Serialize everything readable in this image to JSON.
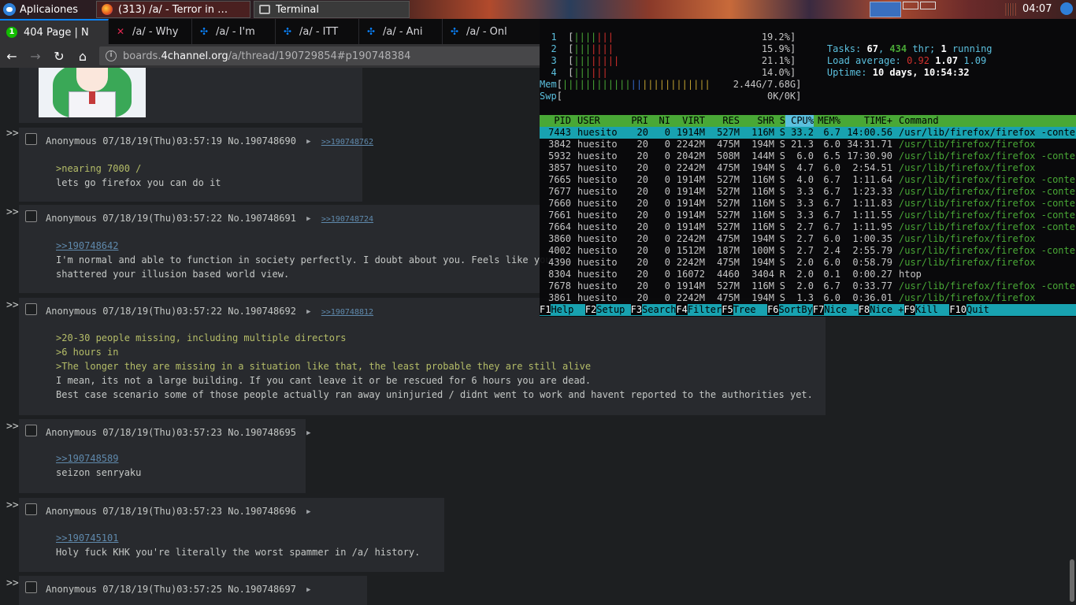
{
  "panel": {
    "apps_label": "Aplicaiones",
    "tasks": [
      {
        "title": "(313) /a/ - Terror in …",
        "icon": "firefox-icon"
      },
      {
        "title": "Terminal",
        "icon": "terminal-icon"
      }
    ],
    "clock": "04:07"
  },
  "browser": {
    "tabs": [
      {
        "badge": "1",
        "title": "404 Page | N"
      },
      {
        "title": "/a/ - Why"
      },
      {
        "title": "/a/ - I'm"
      },
      {
        "title": "/a/ - ITT"
      },
      {
        "title": "/a/ - Ani"
      },
      {
        "title": "/a/ - Onl"
      }
    ],
    "url_domain_prefix": "boards.",
    "url_domain": "4channel.org",
    "url_path": "/a/thread/190729854#p190748384"
  },
  "posts": [
    {
      "name": "Anonymous",
      "date": "07/18/19(Thu)03:57:19",
      "no": "No.190748690",
      "backlink": ">>190748762",
      "lines": [
        {
          "t": ">nearing 7000 /",
          "k": "quote"
        },
        {
          "t": "lets go firefox you can do it",
          "k": "text"
        }
      ]
    },
    {
      "name": "Anonymous",
      "date": "07/18/19(Thu)03:57:22",
      "no": "No.190748691",
      "backlink": ">>190748724",
      "lines": [
        {
          "t": ">>190748642",
          "k": "link"
        },
        {
          "t": "I'm normal and able to function in society perfectly. I doubt about you. Feels like you",
          "k": "text"
        },
        {
          "t": "shattered your illusion based world view.",
          "k": "text"
        }
      ]
    },
    {
      "name": "Anonymous",
      "date": "07/18/19(Thu)03:57:22",
      "no": "No.190748692",
      "backlink": ">>190748812",
      "lines": [
        {
          "t": ">20-30 people missing, including multiple directors",
          "k": "quote"
        },
        {
          "t": ">6 hours in",
          "k": "quote"
        },
        {
          "t": ">The longer they are missing in a situation like that, the least probable they are still alive",
          "k": "quote"
        },
        {
          "t": "I mean, its not a large building. If you cant leave it or be rescued for 6 hours you are dead.",
          "k": "text"
        },
        {
          "t": "Best case scenario some of those people actually ran away uninjuried / didnt went to work and havent reported to the authorities yet.",
          "k": "text"
        }
      ]
    },
    {
      "name": "Anonymous",
      "date": "07/18/19(Thu)03:57:23",
      "no": "No.190748695",
      "backlink": "",
      "lines": [
        {
          "t": ">>190748589",
          "k": "link"
        },
        {
          "t": "seizon senryaku",
          "k": "text"
        }
      ]
    },
    {
      "name": "Anonymous",
      "date": "07/18/19(Thu)03:57:23",
      "no": "No.190748696",
      "backlink": "",
      "lines": [
        {
          "t": ">>190745101",
          "k": "link"
        },
        {
          "t": "Holy fuck KHK you're literally the worst spammer in /a/ history.",
          "k": "text"
        }
      ]
    },
    {
      "name": "Anonymous",
      "date": "07/18/19(Thu)03:57:25",
      "no": "No.190748697",
      "backlink": "",
      "lines": []
    }
  ],
  "post_arrow": ">>",
  "htop": {
    "cpus": [
      {
        "n": "1",
        "bars": [
          {
            "c": "g",
            "t": "||||"
          },
          {
            "c": "r",
            "t": "|||"
          }
        ],
        "pct": "19.2%"
      },
      {
        "n": "2",
        "bars": [
          {
            "c": "g",
            "t": "|||"
          },
          {
            "c": "r",
            "t": "||||"
          }
        ],
        "pct": "15.9%"
      },
      {
        "n": "3",
        "bars": [
          {
            "c": "g",
            "t": "|||"
          },
          {
            "c": "r",
            "t": "|||||"
          }
        ],
        "pct": "21.1%"
      },
      {
        "n": "4",
        "bars": [
          {
            "c": "g",
            "t": "|||"
          },
          {
            "c": "r",
            "t": "|||"
          }
        ],
        "pct": "14.0%"
      }
    ],
    "mem": {
      "label": "Mem",
      "bars": [
        {
          "c": "g",
          "t": "||||||||||||"
        },
        {
          "c": "b",
          "t": "||"
        },
        {
          "c": "y",
          "t": "||||||||||||"
        }
      ],
      "value": "2.44G/7.68G"
    },
    "swp": {
      "label": "Swp",
      "value": "0K/0K"
    },
    "tasks": {
      "label": "Tasks:",
      "count": "67",
      "thr": "434",
      "thr_label": "thr;",
      "running": "1",
      "running_label": "running"
    },
    "load": {
      "label": "Load average:",
      "v1": "0.92",
      "v5": "1.07",
      "v15": "1.09"
    },
    "uptime": {
      "label": "Uptime:",
      "value": "10 days, 10:54:32"
    },
    "columns": [
      "PID",
      "USER",
      "PRI",
      "NI",
      "VIRT",
      "RES",
      "SHR",
      "S",
      "CPU%",
      "MEM%",
      "TIME+",
      "Command"
    ],
    "processes": [
      {
        "pid": "7443",
        "user": "huesito",
        "pri": "20",
        "ni": "0",
        "virt": "1914M",
        "res": "527M",
        "shr": "116M",
        "s": "S",
        "cpu": "33.2",
        "mem": "6.7",
        "time": "14:00.56",
        "cmd": "/usr/lib/firefox/firefox",
        "args": " -contentp"
      },
      {
        "pid": "3842",
        "user": "huesito",
        "pri": "20",
        "ni": "0",
        "virt": "2242M",
        "res": "475M",
        "shr": "194M",
        "s": "S",
        "cpu": "21.3",
        "mem": "6.0",
        "time": "34:31.71",
        "cmd": "/usr/lib/firefox/firefox",
        "args": ""
      },
      {
        "pid": "5932",
        "user": "huesito",
        "pri": "20",
        "ni": "0",
        "virt": "2042M",
        "res": "508M",
        "shr": "144M",
        "s": "S",
        "cpu": "6.0",
        "mem": "6.5",
        "time": "17:30.90",
        "cmd": "/usr/lib/firefox/firefox",
        "args": " -contentp"
      },
      {
        "pid": "3857",
        "user": "huesito",
        "pri": "20",
        "ni": "0",
        "virt": "2242M",
        "res": "475M",
        "shr": "194M",
        "s": "S",
        "cpu": "4.7",
        "mem": "6.0",
        "time": "2:54.51",
        "cmd": "/usr/lib/firefox/firefox",
        "args": ""
      },
      {
        "pid": "7665",
        "user": "huesito",
        "pri": "20",
        "ni": "0",
        "virt": "1914M",
        "res": "527M",
        "shr": "116M",
        "s": "S",
        "cpu": "4.0",
        "mem": "6.7",
        "time": "1:11.64",
        "cmd": "/usr/lib/firefox/firefox",
        "args": " -contentp"
      },
      {
        "pid": "7677",
        "user": "huesito",
        "pri": "20",
        "ni": "0",
        "virt": "1914M",
        "res": "527M",
        "shr": "116M",
        "s": "S",
        "cpu": "3.3",
        "mem": "6.7",
        "time": "1:23.33",
        "cmd": "/usr/lib/firefox/firefox",
        "args": " -contentp"
      },
      {
        "pid": "7660",
        "user": "huesito",
        "pri": "20",
        "ni": "0",
        "virt": "1914M",
        "res": "527M",
        "shr": "116M",
        "s": "S",
        "cpu": "3.3",
        "mem": "6.7",
        "time": "1:11.83",
        "cmd": "/usr/lib/firefox/firefox",
        "args": " -contentp"
      },
      {
        "pid": "7661",
        "user": "huesito",
        "pri": "20",
        "ni": "0",
        "virt": "1914M",
        "res": "527M",
        "shr": "116M",
        "s": "S",
        "cpu": "3.3",
        "mem": "6.7",
        "time": "1:11.55",
        "cmd": "/usr/lib/firefox/firefox",
        "args": " -contentp"
      },
      {
        "pid": "7664",
        "user": "huesito",
        "pri": "20",
        "ni": "0",
        "virt": "1914M",
        "res": "527M",
        "shr": "116M",
        "s": "S",
        "cpu": "2.7",
        "mem": "6.7",
        "time": "1:11.95",
        "cmd": "/usr/lib/firefox/firefox",
        "args": " -contentp"
      },
      {
        "pid": "3860",
        "user": "huesito",
        "pri": "20",
        "ni": "0",
        "virt": "2242M",
        "res": "475M",
        "shr": "194M",
        "s": "S",
        "cpu": "2.7",
        "mem": "6.0",
        "time": "1:00.35",
        "cmd": "/usr/lib/firefox/firefox",
        "args": ""
      },
      {
        "pid": "4002",
        "user": "huesito",
        "pri": "20",
        "ni": "0",
        "virt": "1512M",
        "res": "187M",
        "shr": "100M",
        "s": "S",
        "cpu": "2.7",
        "mem": "2.4",
        "time": "2:55.79",
        "cmd": "/usr/lib/firefox/firefox",
        "args": " -contentp"
      },
      {
        "pid": "4390",
        "user": "huesito",
        "pri": "20",
        "ni": "0",
        "virt": "2242M",
        "res": "475M",
        "shr": "194M",
        "s": "S",
        "cpu": "2.0",
        "mem": "6.0",
        "time": "0:58.79",
        "cmd": "/usr/lib/firefox/firefox",
        "args": ""
      },
      {
        "pid": "8304",
        "user": "huesito",
        "pri": "20",
        "ni": "0",
        "virt": "16072",
        "res": "4460",
        "shr": "3404",
        "s": "R",
        "cpu": "2.0",
        "mem": "0.1",
        "time": "0:00.27",
        "cmd": "htop",
        "args": ""
      },
      {
        "pid": "7678",
        "user": "huesito",
        "pri": "20",
        "ni": "0",
        "virt": "1914M",
        "res": "527M",
        "shr": "116M",
        "s": "S",
        "cpu": "2.0",
        "mem": "6.7",
        "time": "0:33.77",
        "cmd": "/usr/lib/firefox/firefox",
        "args": " -contentp"
      },
      {
        "pid": "3861",
        "user": "huesito",
        "pri": "20",
        "ni": "0",
        "virt": "2242M",
        "res": "475M",
        "shr": "194M",
        "s": "S",
        "cpu": "1.3",
        "mem": "6.0",
        "time": "0:36.01",
        "cmd": "/usr/lib/firefox/firefox",
        "args": ""
      }
    ],
    "fkeys": [
      {
        "k": "F1",
        "l": "Help  "
      },
      {
        "k": "F2",
        "l": "Setup "
      },
      {
        "k": "F3",
        "l": "Search"
      },
      {
        "k": "F4",
        "l": "Filter"
      },
      {
        "k": "F5",
        "l": "Tree  "
      },
      {
        "k": "F6",
        "l": "SortBy"
      },
      {
        "k": "F7",
        "l": "Nice -"
      },
      {
        "k": "F8",
        "l": "Nice +"
      },
      {
        "k": "F9",
        "l": "Kill  "
      },
      {
        "k": "F10",
        "l": "Quit  "
      }
    ]
  },
  "colors": {
    "accent": "#0a84ff",
    "quote_green": "#b5bd68",
    "link_blue": "#5f89ac",
    "htop_green": "#49a836",
    "htop_cyan": "#18a2b0"
  }
}
